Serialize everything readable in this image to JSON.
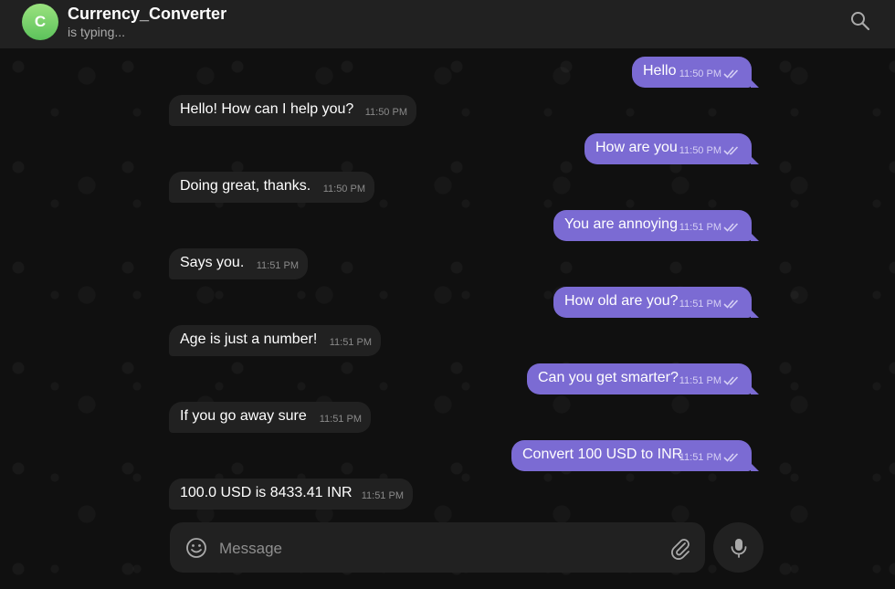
{
  "header": {
    "avatar_letter": "C",
    "title": "Currency_Converter",
    "status": "is typing..."
  },
  "messages": [
    {
      "dir": "out",
      "text": "Hello",
      "time": "11:50 PM",
      "read": true
    },
    {
      "dir": "in",
      "text": "Hello! How can I help you?",
      "time": "11:50 PM"
    },
    {
      "dir": "out",
      "text": "How are you",
      "time": "11:50 PM",
      "read": true
    },
    {
      "dir": "in",
      "text": "Doing great, thanks.",
      "time": "11:50 PM"
    },
    {
      "dir": "out",
      "text": "You are annoying",
      "time": "11:51 PM",
      "read": true
    },
    {
      "dir": "in",
      "text": "Says you.",
      "time": "11:51 PM"
    },
    {
      "dir": "out",
      "text": "How old are you?",
      "time": "11:51 PM",
      "read": true
    },
    {
      "dir": "in",
      "text": "Age is just a number!",
      "time": "11:51 PM"
    },
    {
      "dir": "out",
      "text": "Can you get smarter?",
      "time": "11:51 PM",
      "read": true
    },
    {
      "dir": "in",
      "text": "If you go away sure",
      "time": "11:51 PM"
    },
    {
      "dir": "out",
      "text": "Convert 100 USD to INR",
      "time": "11:51 PM",
      "read": true
    },
    {
      "dir": "in",
      "text": "100.0 USD is 8433.41 INR",
      "time": "11:51 PM"
    }
  ],
  "composer": {
    "placeholder": "Message",
    "value": ""
  },
  "icons": {
    "search": "search-icon",
    "emoji": "emoji-icon",
    "attach": "paperclip-icon",
    "mic": "microphone-icon",
    "read_receipt": "double-check-icon"
  },
  "colors": {
    "outgoing_bubble": "#7b6bd3",
    "incoming_bubble": "#212121",
    "header": "#212121",
    "avatar": "#6fcf66"
  }
}
